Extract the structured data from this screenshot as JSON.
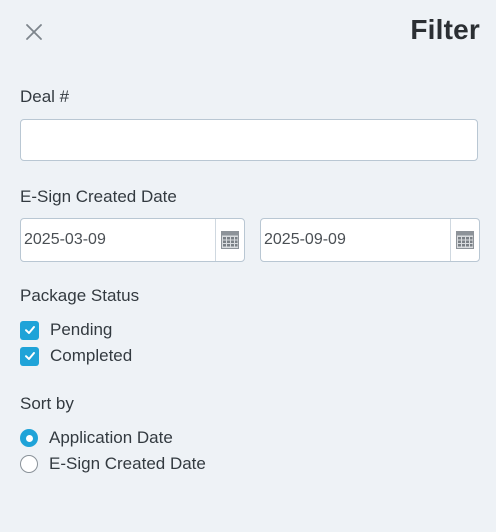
{
  "header": {
    "title": "Filter",
    "close_icon": "close-icon"
  },
  "deal": {
    "label": "Deal #",
    "value": ""
  },
  "esign_created_date": {
    "label": "E-Sign Created Date",
    "from": "2025-03-09",
    "to": "2025-09-09",
    "icon": "calendar-icon"
  },
  "package_status": {
    "label": "Package Status",
    "options": [
      {
        "label": "Pending",
        "checked": true
      },
      {
        "label": "Completed",
        "checked": true
      }
    ]
  },
  "sort_by": {
    "label": "Sort by",
    "options": [
      {
        "label": "Application Date",
        "selected": true
      },
      {
        "label": "E-Sign Created Date",
        "selected": false
      }
    ]
  },
  "colors": {
    "accent": "#1fa3d8",
    "background": "#eef2f6",
    "border": "#b9c7d3"
  }
}
